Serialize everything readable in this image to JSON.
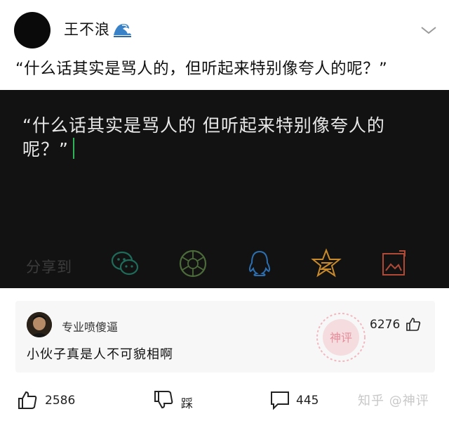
{
  "post": {
    "username": "王不浪",
    "username_emoji": "wave-emoji",
    "title": "“什么话其实是骂人的，但听起来特别像夸人的呢？”"
  },
  "card": {
    "quote": "“什么话其实是骂人的 但听起来特别像夸人的呢？”",
    "share_label": "分享到",
    "share_icons": [
      "wechat-icon",
      "moments-icon",
      "qq-icon",
      "qzone-icon",
      "save-image-icon"
    ],
    "background": "#121212",
    "cursor_color": "#2fb45a"
  },
  "comment": {
    "commenter": "专业喷傻逼",
    "likes": "6276",
    "text": "小伙子真是人不可貌相啊",
    "stamp_text": "神评"
  },
  "footer": {
    "likes": "2586",
    "dislike_label": "踩",
    "comments": "445",
    "watermark": "知乎 @神评"
  }
}
